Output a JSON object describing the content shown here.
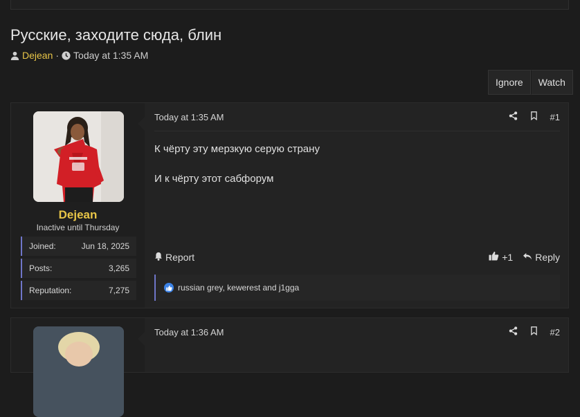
{
  "thread": {
    "title": "Русские, заходите сюда, блин",
    "author": "Dejean",
    "separator": "·",
    "date": "Today at 1:35 AM",
    "ignore_label": "Ignore",
    "watch_label": "Watch"
  },
  "posts": [
    {
      "username": "Dejean",
      "user_title": "Inactive until Thursday",
      "stats": [
        {
          "label": "Joined:",
          "value": "Jun 18, 2025"
        },
        {
          "label": "Posts:",
          "value": "3,265"
        },
        {
          "label": "Reputation:",
          "value": "7,275"
        }
      ],
      "date": "Today at 1:35 AM",
      "number": "#1",
      "body": [
        "К чёрту эту мерзкую серую страну",
        "И к чёрту этот сабфорум"
      ],
      "report_label": "Report",
      "like_count": "+1",
      "reply_label": "Reply",
      "reactions_text": "russian grey, kewerest and j1gga"
    },
    {
      "date": "Today at 1:36 AM",
      "number": "#2"
    }
  ],
  "colors": {
    "accent": "#e8c547",
    "stat_border": "#6f76c9",
    "like": "#3b82e6"
  }
}
